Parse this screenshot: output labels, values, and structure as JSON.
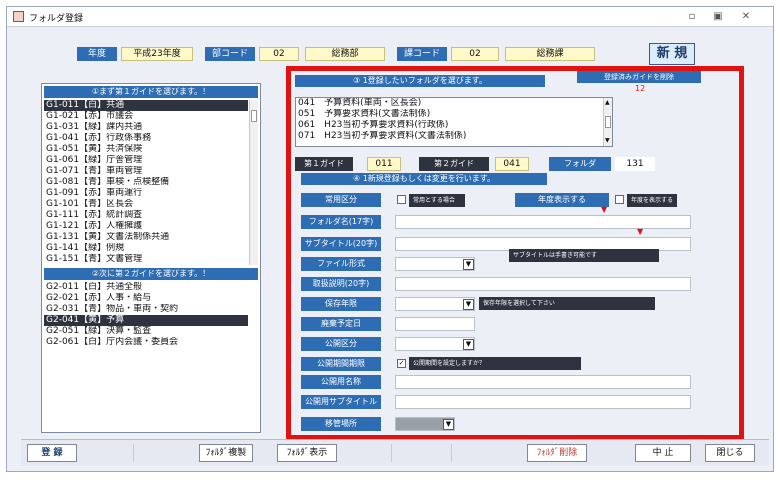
{
  "window": {
    "title": "フォルダ登録",
    "controls": [
      "▫",
      "▣",
      "✕"
    ]
  },
  "header": {
    "year_label": "年度",
    "year_value": "平成23年度",
    "dept_code_label": "部コード",
    "dept_code_value": "02",
    "dept_name_value": "総務部",
    "section_code_label": "課コード",
    "section_code_value": "02",
    "section_name_value": "総務課",
    "new_button": "新 規"
  },
  "left_panel": {
    "guide1_header": "①まず第１ガイドを選びます。！",
    "guide1_items": [
      "G1-011【白】共通",
      "G1-021【赤】市議会",
      "G1-031【緑】課内共通",
      "G1-041【赤】行政係事務",
      "G1-051【黄】共済保険",
      "G1-061【緑】庁舎管理",
      "G1-071【青】車両管理",
      "G1-081【青】車検・点検整備",
      "G1-091【赤】車両運行",
      "G1-101【青】区長会",
      "G1-111【赤】統計調査",
      "G1-121【赤】人権擁護",
      "G1-131【黄】文書法制係共通",
      "G1-141【緑】例規",
      "G1-151【青】文書管理"
    ],
    "guide1_selected_index": 0,
    "guide2_header": "②次に第２ガイドを選びます。！",
    "guide2_items": [
      "G2-011【白】共通全般",
      "G2-021【赤】人事・給与",
      "G2-031【青】物品・車両・契約",
      "G2-041【黄】予算",
      "G2-051【緑】決算・監査",
      "G2-061【白】庁内会議・委員会"
    ],
    "guide2_selected_index": 3
  },
  "right_panel": {
    "folder_header": "③ 1登録したいフォルダを選びます。",
    "register_button": "登録済みガイドを削除",
    "register_count": "12",
    "folder_items": [
      "041　予算資料(車両・区長会)",
      "051　予算要求資料(文書法制係)",
      "061　H23当初予算要求資料(行政係)",
      "071　H23当初予算要求資料(文書法制係)"
    ],
    "guide1_label": "第１ガイド",
    "guide1_value": "011",
    "guide2_label": "第２ガイド",
    "guide2_value": "041",
    "folder_label": "フォルダ",
    "folder_value": "131",
    "step4_header": "④ 1新規登録もしくは変更を行います。",
    "fields": {
      "jouyou_kubun": "常用区分",
      "jouyou_note": "常用とする場合",
      "nendo_hyouji": "年度表示する",
      "nendo_note": "年度を表示する",
      "folder_name": "フォルダ名(17字)",
      "subtitle": "サブタイトル(20字)",
      "subtitle_note": "サブタイトルは手書き可能です",
      "file_format": "ファイル形式",
      "explanation": "取扱説明(20字)",
      "hozon_nengen": "保存年限",
      "hozon_note": "保存年限を選択して下さい",
      "haiki_yotei": "廃棄予定日",
      "koukai_kubun": "公開区分",
      "koukai_kigen": "公開期間期限",
      "koukai_note": "公開期間を設定しますか？",
      "koukai_name": "公開用名称",
      "koukai_subtitle": "公開用サブタイトル",
      "ikan_basho": "移管場所"
    }
  },
  "bottom": {
    "register": "登 録",
    "folder_copy": "ﾌｫﾙﾀﾞ複製",
    "folder_display": "ﾌｫﾙﾀﾞ表示",
    "folder_delete": "ﾌｫﾙﾀﾞ削除",
    "stop": "中 止",
    "close": "閉じる"
  },
  "colors": {
    "highlight_border": "#e01313",
    "header_blue": "#2e6db3",
    "dark_label": "#2f3340",
    "value_yellow": "#fff9c9"
  }
}
